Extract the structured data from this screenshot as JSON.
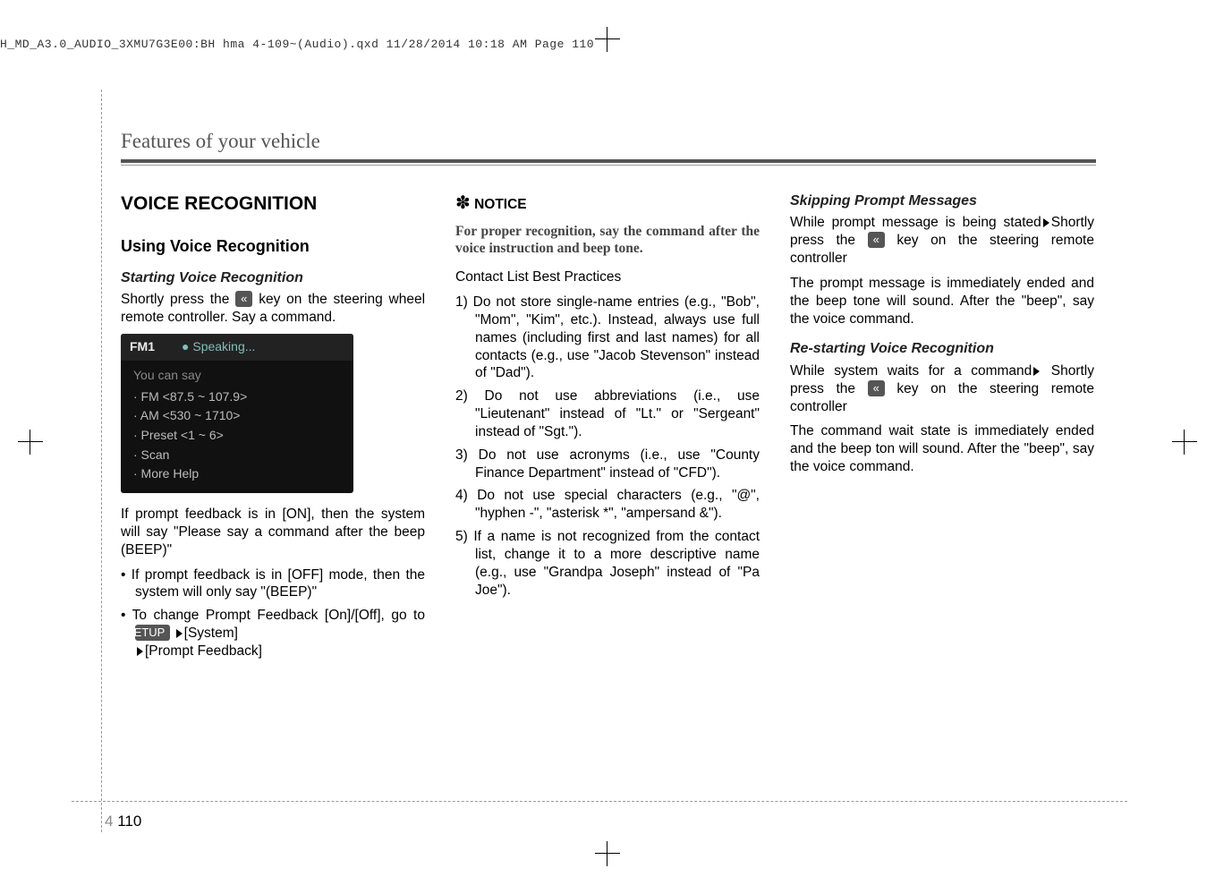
{
  "meta": {
    "header_print_line": "H_MD_A3.0_AUDIO_3XMU7G3E00:BH hma 4-109~(Audio).qxd  11/28/2014  10:18 AM  Page 110"
  },
  "section_header": "Features of your vehicle",
  "page_number": {
    "chapter": "4",
    "page": "110"
  },
  "col1": {
    "h1": "VOICE RECOGNITION",
    "h2": "Using Voice Recognition",
    "h3": "Starting Voice Recognition",
    "p1a": "Shortly press the ",
    "p1b": " key on the steering wheel remote controller. Say a command.",
    "screen": {
      "band": "FM1",
      "status_mic": "●",
      "status": "Speaking...",
      "say": "You can say",
      "lines": [
        "· FM <87.5 ~ 107.9>",
        "· AM <530 ~ 1710>",
        "· Preset <1 ~ 6>",
        "· Scan",
        "· More Help"
      ]
    },
    "p2": "If prompt feedback is in [ON], then the system will say \"Please say a command after the beep (BEEP)\"",
    "b1": "• If prompt feedback is in [OFF] mode, then the system will only say \"(BEEP)\"",
    "b2a": "• To change Prompt Feedback [On]/[Off], go to ",
    "setup_label": "SETUP",
    "b2b": "[System]",
    "b2c": "[Prompt Feedback]"
  },
  "col2": {
    "notice_star": "✽",
    "notice_label": " NOTICE",
    "notice_body": "For proper recognition, say the command after the voice instruction and beep tone.",
    "best_head": "Contact List Best Practices",
    "items": [
      "1) Do not store single-name entries (e.g., \"Bob\", \"Mom\", \"Kim\", etc.). Instead, always use full names (including first and last names) for all contacts (e.g., use \"Jacob Stevenson\" instead of \"Dad\").",
      "2) Do not use abbreviations (i.e., use \"Lieutenant\" instead of \"Lt.\" or \"Sergeant\" instead of \"Sgt.\").",
      "3) Do not use acronyms (i.e., use \"County Finance Department\" instead of \"CFD\").",
      "4) Do not use special characters (e.g., \"@\", \"hyphen -\", \"asterisk *\", \"ampersand &\").",
      "5) If a name is not recognized from the contact list, change it to a more descriptive name (e.g., use \"Grandpa Joseph\" instead of \"Pa Joe\")."
    ]
  },
  "col3": {
    "h3a": "Skipping Prompt Messages",
    "p1a": "While prompt message is being stated",
    "p1b": "Shortly press the ",
    "p1c": " key on the steering remote controller",
    "p2": "The prompt message is immediately ended and the beep tone will sound. After the \"beep\", say the voice command.",
    "h3b": "Re-starting Voice Recognition",
    "p3a": "While system waits for a command",
    "p3b": "Shortly press the ",
    "p3c": " key on the steering remote controller",
    "p4": "The command wait state is immediately ended and the beep ton will sound. After the \"beep\", say the voice command."
  }
}
